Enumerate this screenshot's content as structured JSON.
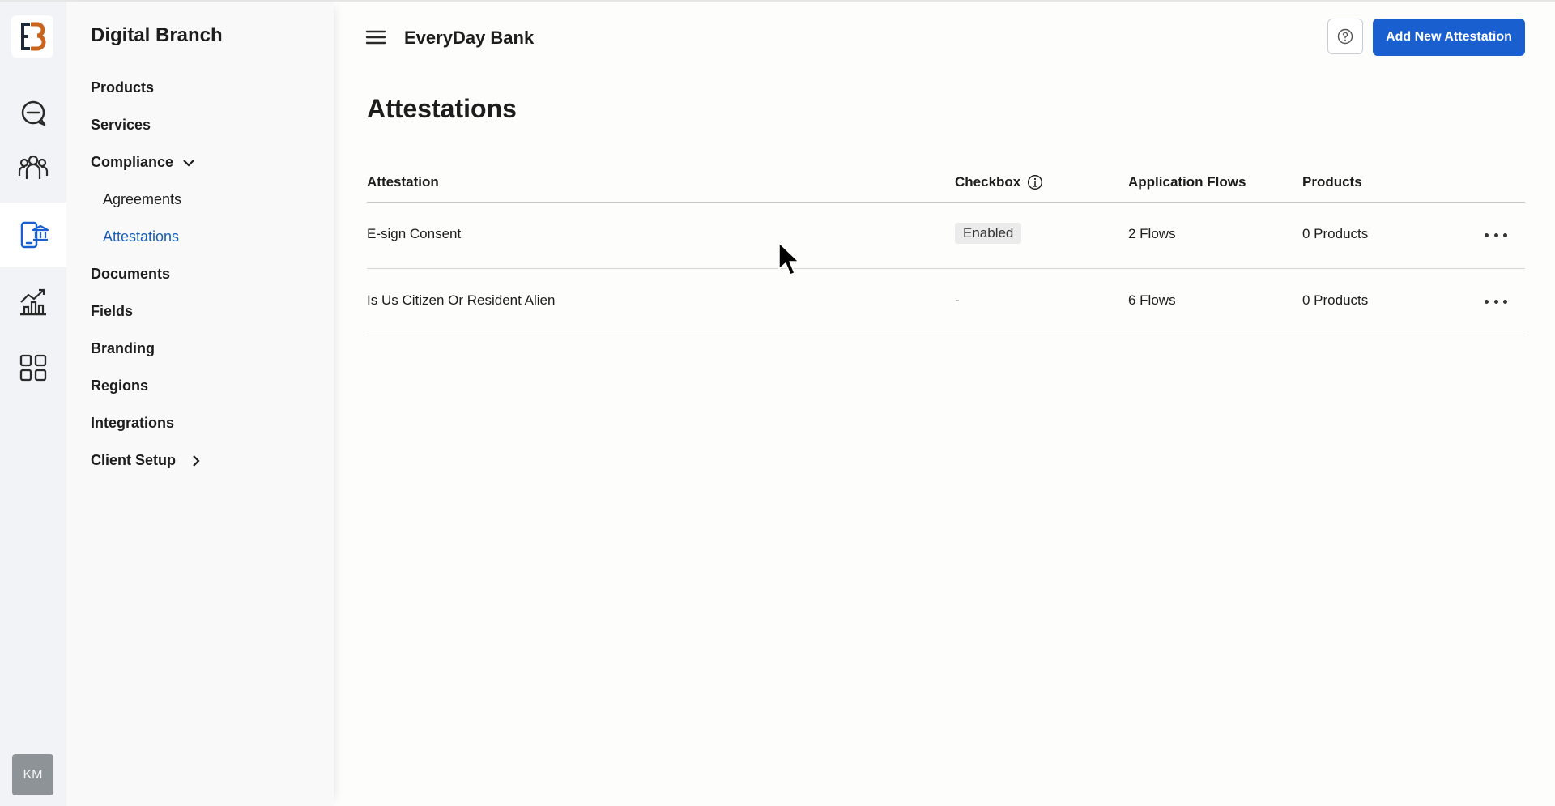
{
  "rail": {
    "items": [
      {
        "name": "messages",
        "active": false
      },
      {
        "name": "users",
        "active": false
      },
      {
        "name": "digital-branch",
        "active": true
      },
      {
        "name": "analytics",
        "active": false
      },
      {
        "name": "apps",
        "active": false
      }
    ],
    "avatar": "KM"
  },
  "subnav": {
    "title": "Digital Branch",
    "items": [
      {
        "label": "Products"
      },
      {
        "label": "Services"
      },
      {
        "label": "Compliance"
      },
      {
        "label": "Agreements"
      },
      {
        "label": "Attestations"
      },
      {
        "label": "Documents"
      },
      {
        "label": "Fields"
      },
      {
        "label": "Branding"
      },
      {
        "label": "Regions"
      },
      {
        "label": "Integrations"
      },
      {
        "label": "Client Setup"
      }
    ]
  },
  "header": {
    "bank_name": "EveryDay Bank",
    "add_button": "Add New Attestation"
  },
  "page": {
    "title": "Attestations"
  },
  "table": {
    "columns": [
      "Attestation",
      "Checkbox",
      "Application Flows",
      "Products"
    ],
    "rows": [
      {
        "attestation": "E-sign Consent",
        "checkbox": "Enabled",
        "flows": "2 Flows",
        "products": "0 Products"
      },
      {
        "attestation": "Is Us Citizen Or Resident Alien",
        "checkbox": "-",
        "flows": "6 Flows",
        "products": "0 Products"
      }
    ]
  },
  "colors": {
    "accent": "#1a5fcf",
    "active_link": "#1a5fb4",
    "logo_dark": "#1f2a38",
    "logo_orange": "#c8641e"
  }
}
